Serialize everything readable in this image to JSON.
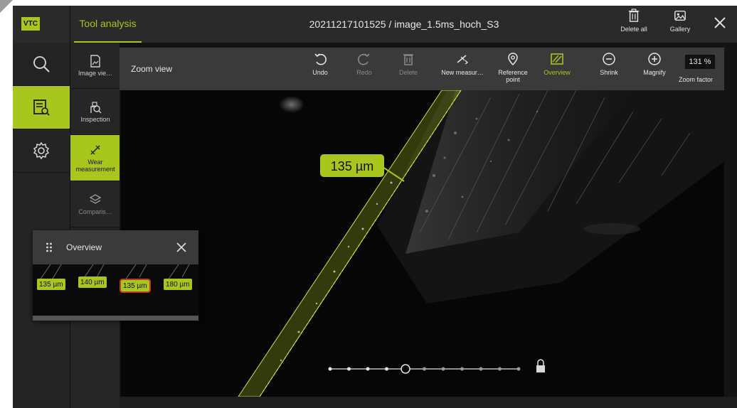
{
  "header": {
    "logo": "VTC",
    "app_title": "Tool analysis",
    "file_title": "20211217101525 / image_1.5ms_hoch_S3",
    "delete_all_label": "Delete all",
    "gallery_label": "Gallery"
  },
  "sidebar": {
    "items": [
      {
        "icon": "search-icon"
      },
      {
        "icon": "tool-analysis-icon",
        "active": true
      },
      {
        "icon": "settings-icon"
      }
    ]
  },
  "subnav": {
    "items": [
      {
        "label": "Image vie…",
        "icon": "image-view-icon"
      },
      {
        "label": "Inspection",
        "icon": "inspection-icon"
      },
      {
        "label": "Wear measurement",
        "icon": "wear-measurement-icon",
        "active": true
      },
      {
        "label": "Comparis…",
        "icon": "comparison-icon"
      }
    ]
  },
  "zoombar": {
    "title": "Zoom view",
    "undo": "Undo",
    "redo": "Redo",
    "delete": "Delete",
    "new_measurement": "New measur…",
    "reference_point": "Reference point",
    "overview": "Overview",
    "shrink": "Shrink",
    "magnify": "Magnify",
    "zoom_factor_label": "Zoom factor",
    "zoom_factor_value": "131 %"
  },
  "measurement": {
    "label": "135 µm"
  },
  "overview_panel": {
    "title": "Overview",
    "tags": [
      "135 µm",
      "140 µm",
      "135 µm",
      "180 µm"
    ],
    "selected_index": 2
  },
  "pager": {
    "total_dots": 11,
    "current_index": 4
  },
  "colors": {
    "accent": "#a8c61e",
    "selected": "#c0392b"
  }
}
